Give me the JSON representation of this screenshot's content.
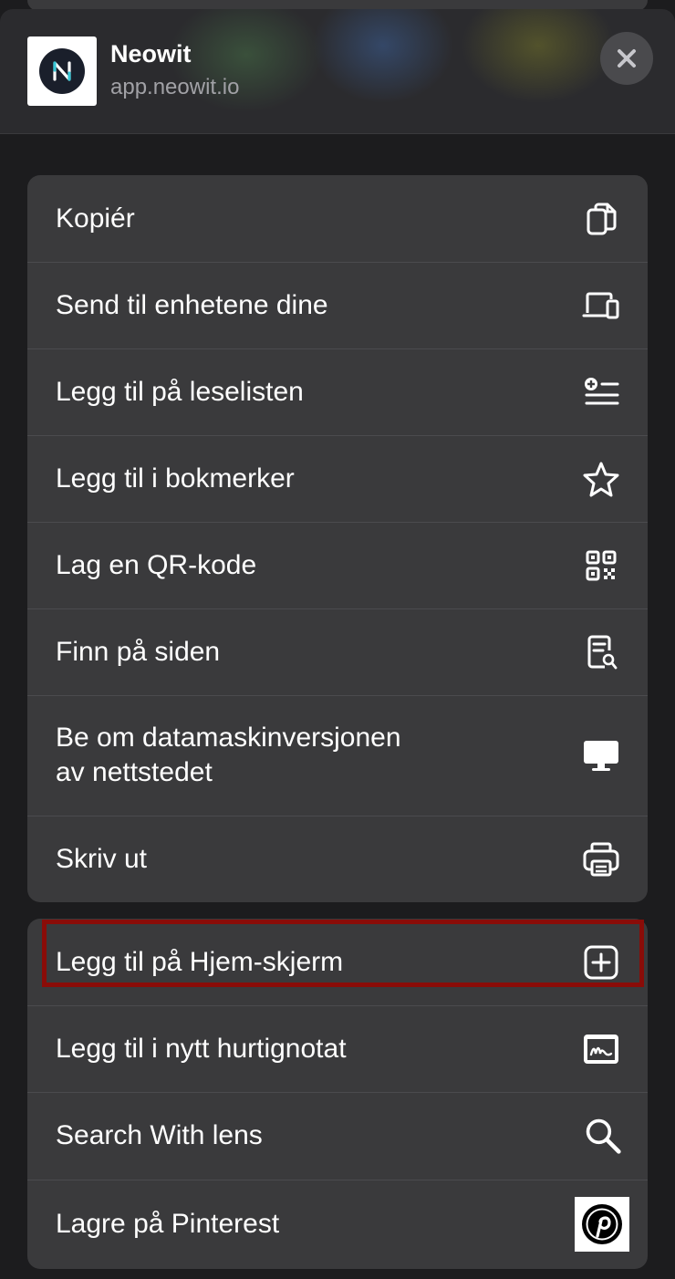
{
  "header": {
    "app_title": "Neowit",
    "app_url": "app.neowit.io",
    "logo_letter": "N",
    "logo_accent": "#35c6d6"
  },
  "close_button": {
    "icon": "close-icon"
  },
  "group1": {
    "items": [
      {
        "label": "Kopiér",
        "icon": "copy-icon"
      },
      {
        "label": "Send til enhetene dine",
        "icon": "devices-icon"
      },
      {
        "label": "Legg til på leselisten",
        "icon": "reading-list-icon"
      },
      {
        "label": "Legg til i bokmerker",
        "icon": "star-icon"
      },
      {
        "label": "Lag en QR-kode",
        "icon": "qr-code-icon"
      },
      {
        "label": "Finn på siden",
        "icon": "find-on-page-icon"
      },
      {
        "label": "Be om datamaskinversjonen\nav nettstedet",
        "icon": "desktop-icon"
      },
      {
        "label": "Skriv ut",
        "icon": "printer-icon"
      }
    ]
  },
  "group2": {
    "items": [
      {
        "label": "Legg til på Hjem-skjerm",
        "icon": "add-to-home-icon",
        "highlighted": true
      },
      {
        "label": "Legg til i nytt hurtignotat",
        "icon": "quick-note-icon"
      },
      {
        "label": "Search With lens",
        "icon": "search-icon"
      },
      {
        "label": "Lagre på Pinterest",
        "icon": "pinterest-icon"
      }
    ]
  },
  "colors": {
    "background": "#1c1c1e",
    "row_background": "#3a3a3c",
    "highlight_border": "#8a0c08"
  }
}
